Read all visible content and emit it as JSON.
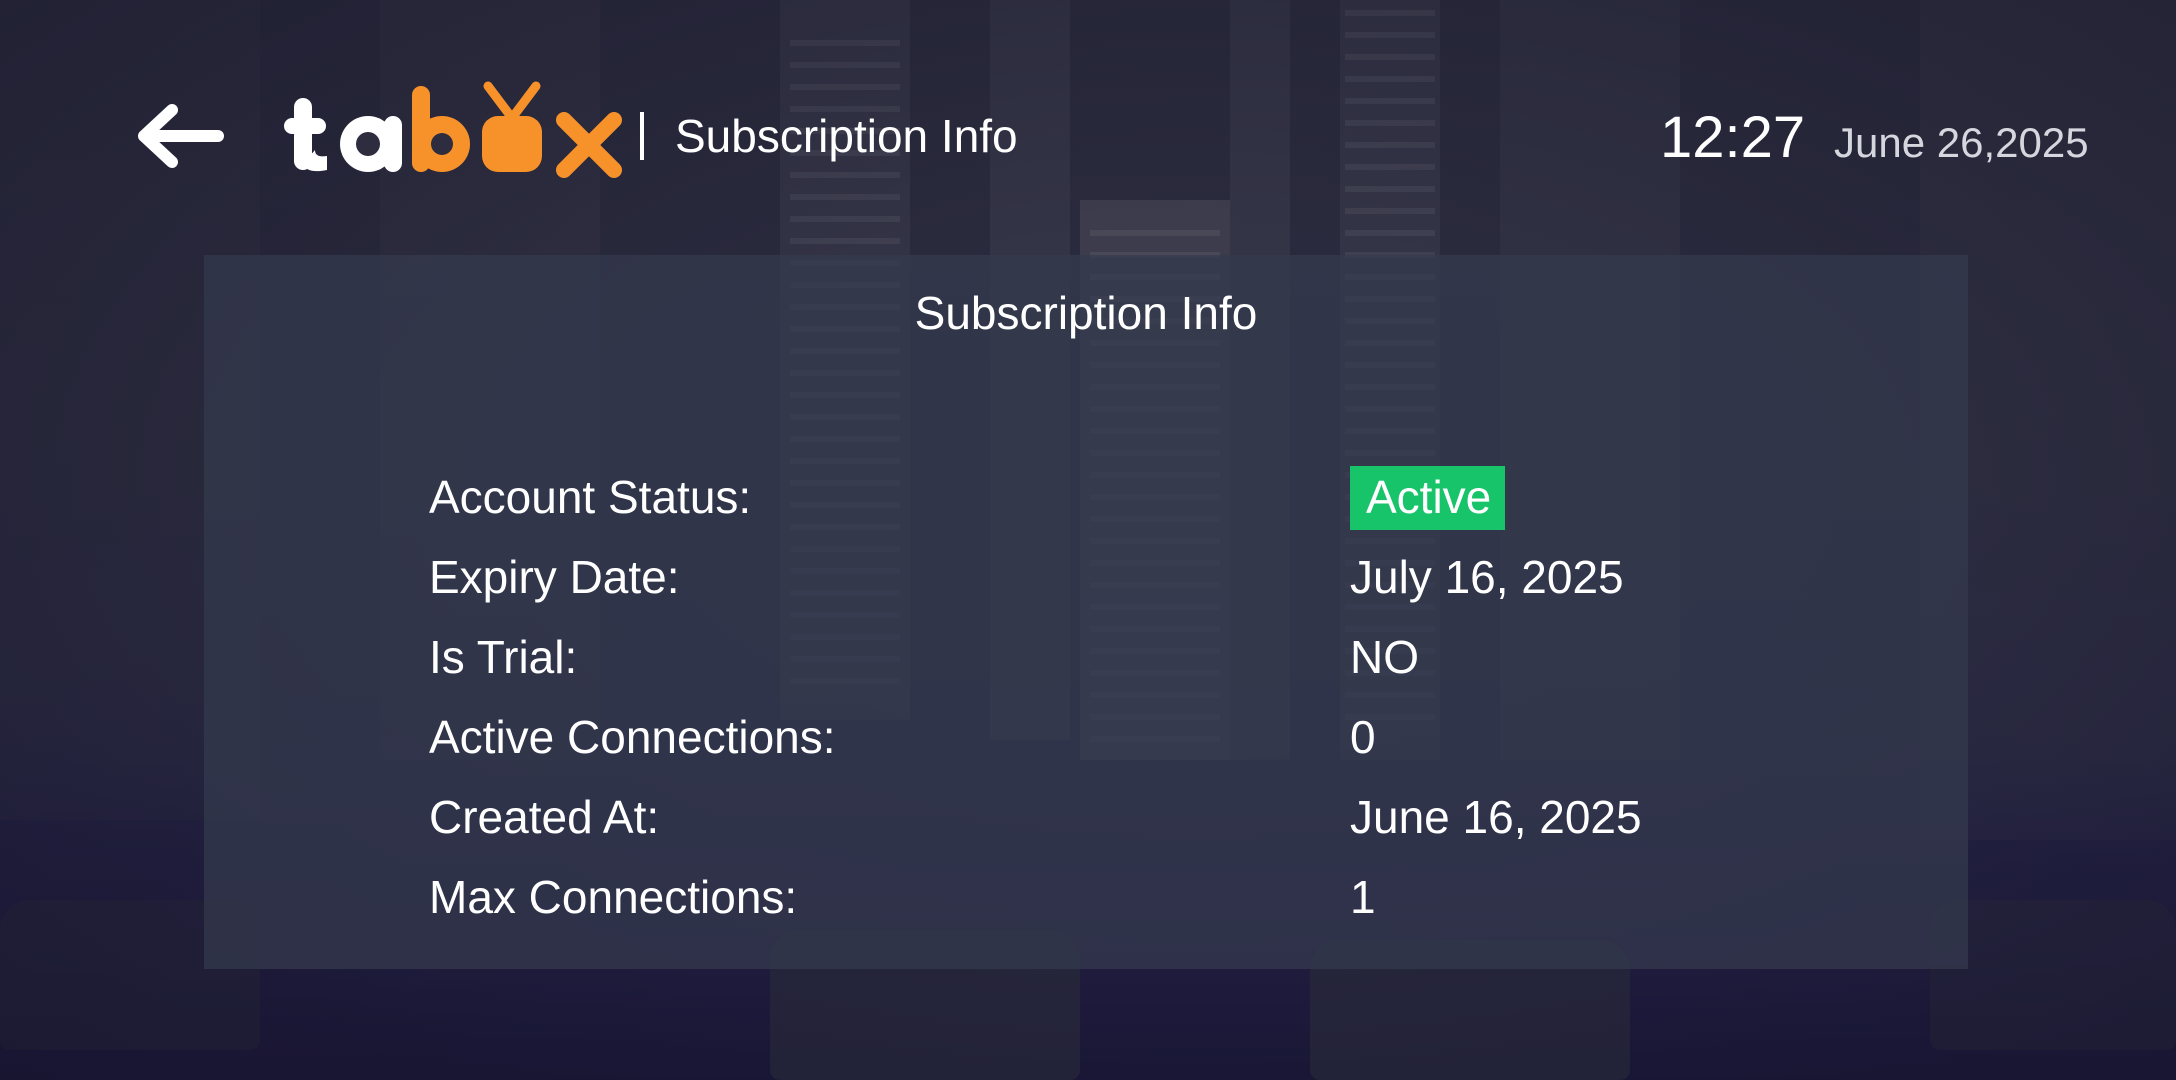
{
  "header": {
    "title": "Subscription Info",
    "time": "12:27",
    "date": "June 26,2025",
    "logo_text": "tabox",
    "back_icon": "arrow-left-icon",
    "logo_icon": "tv-icon"
  },
  "panel": {
    "title": "Subscription Info",
    "rows": [
      {
        "label": "Account Status:",
        "value": "Active"
      },
      {
        "label": "Expiry Date:",
        "value": "July 16, 2025"
      },
      {
        "label": "Is Trial:",
        "value": "NO"
      },
      {
        "label": "Active Connections:",
        "value": "0"
      },
      {
        "label": "Created At:",
        "value": "June 16, 2025"
      },
      {
        "label": "Max Connections:",
        "value": "1"
      }
    ]
  },
  "colors": {
    "logo_white": "#ffffff",
    "logo_orange": "#f7922a",
    "active_badge": "#18c46a"
  }
}
